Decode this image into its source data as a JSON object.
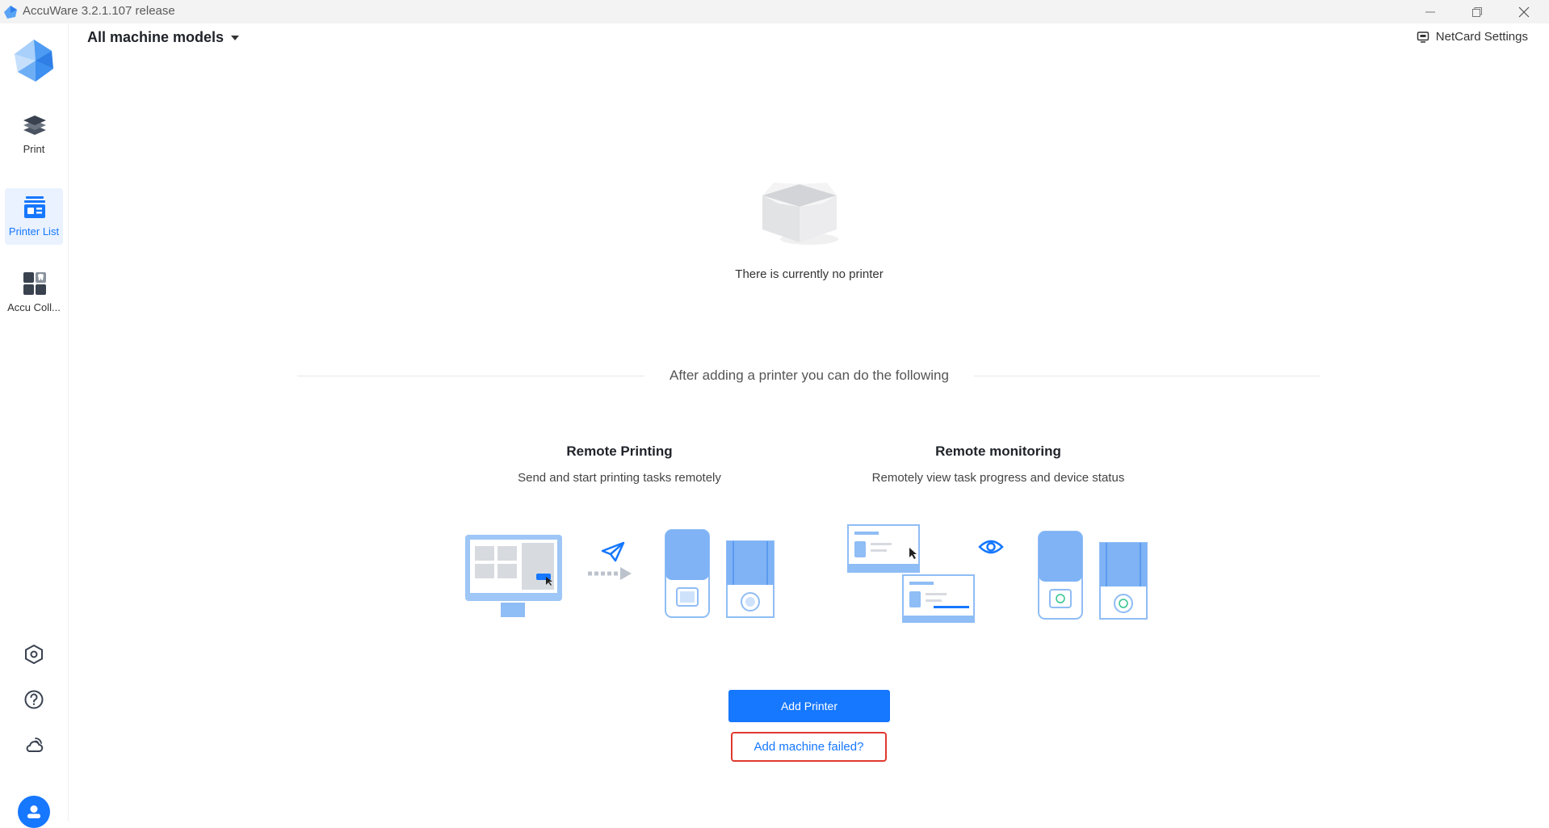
{
  "window": {
    "title": "AccuWare 3.2.1.107 release",
    "controls": [
      "minimize-icon",
      "restore-icon",
      "close-icon"
    ]
  },
  "sidebar": {
    "items": [
      {
        "label": "Print",
        "icon": "layers-icon",
        "active": false
      },
      {
        "label": "Printer List",
        "icon": "printer-list-icon",
        "active": true
      },
      {
        "label": "Accu Coll...",
        "icon": "apps-grid-icon",
        "active": false
      }
    ],
    "bottom_icons": [
      "settings-icon",
      "help-icon",
      "cloud-wifi-icon",
      "user-avatar-icon"
    ]
  },
  "header": {
    "model_filter": "All machine models",
    "netcard_label": "NetCard Settings"
  },
  "empty_state": {
    "message": "There is currently no printer"
  },
  "section_divider": "After adding a printer you can do the following",
  "features": [
    {
      "title": "Remote Printing",
      "description": "Send and start printing tasks remotely"
    },
    {
      "title": "Remote monitoring",
      "description": "Remotely view task progress and device status"
    }
  ],
  "actions": {
    "add_printer": "Add Printer",
    "add_failed": "Add machine failed?"
  },
  "colors": {
    "accent": "#1677ff",
    "highlight_border": "#e03a2f",
    "sidebar_active_bg": "#e9f2fe",
    "illustration_blue": "#7fb3f5"
  }
}
